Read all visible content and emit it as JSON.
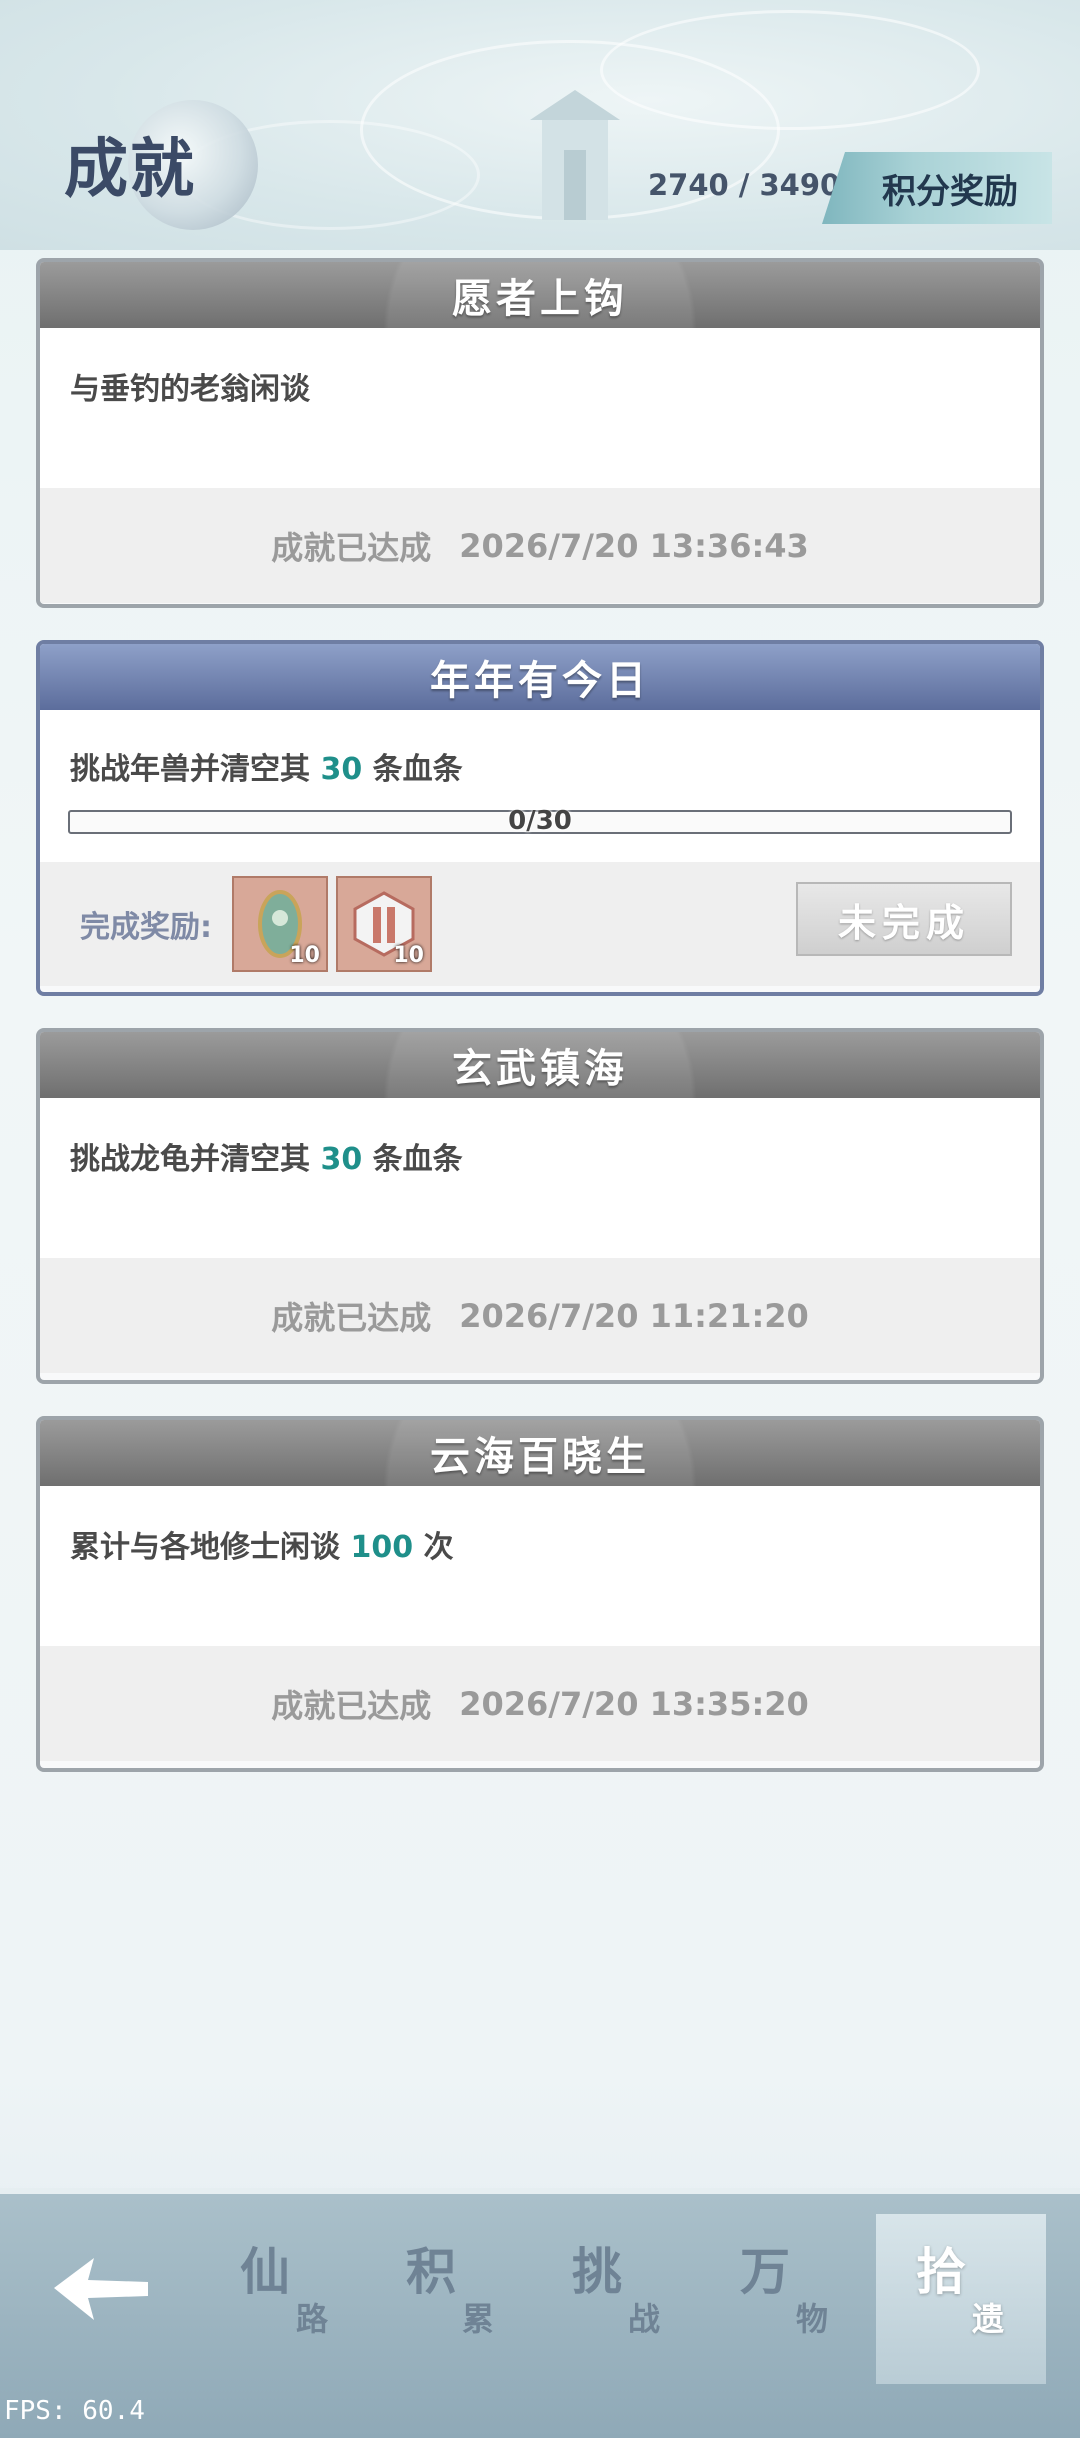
{
  "header": {
    "title": "成就",
    "score": "2740 / 3490",
    "reward_button": "积分奖励"
  },
  "cards": [
    {
      "title": "愿者上钩",
      "desc_pre": "与垂钓的老翁闲谈",
      "desc_num": "",
      "desc_post": "",
      "status": "成就已达成",
      "time": "2026/7/20 13:36:43"
    },
    {
      "title": "年年有今日",
      "desc_pre": "挑战年兽并清空其 ",
      "desc_num": "30",
      "desc_post": " 条血条",
      "progress_text": "0/30",
      "progress_fraction": 0,
      "reward_label": "完成奖励:",
      "reward_items": [
        {
          "icon": "jade-token-icon",
          "count": "10"
        },
        {
          "icon": "hexagon-crystal-icon",
          "count": "10"
        }
      ],
      "button": "未完成"
    },
    {
      "title": "玄武镇海",
      "desc_pre": "挑战龙龟并清空其 ",
      "desc_num": "30",
      "desc_post": " 条血条",
      "status": "成就已达成",
      "time": "2026/7/20 11:21:20"
    },
    {
      "title": "云海百晓生",
      "desc_pre": "累计与各地修士闲谈 ",
      "desc_num": "100",
      "desc_post": " 次",
      "status": "成就已达成",
      "time": "2026/7/20 13:35:20"
    }
  ],
  "nav": {
    "tabs": [
      {
        "big": "仙",
        "small": "路"
      },
      {
        "big": "积",
        "small": "累"
      },
      {
        "big": "挑",
        "small": "战"
      },
      {
        "big": "万",
        "small": "物"
      },
      {
        "big": "拾",
        "small": "遗"
      }
    ],
    "selected_index": 4
  },
  "fps": "FPS: 60.4",
  "colors": {
    "accent_teal": "#1f8f8a",
    "active_header": "#5c6d9c",
    "inactive_header": "#6f6f6f"
  }
}
